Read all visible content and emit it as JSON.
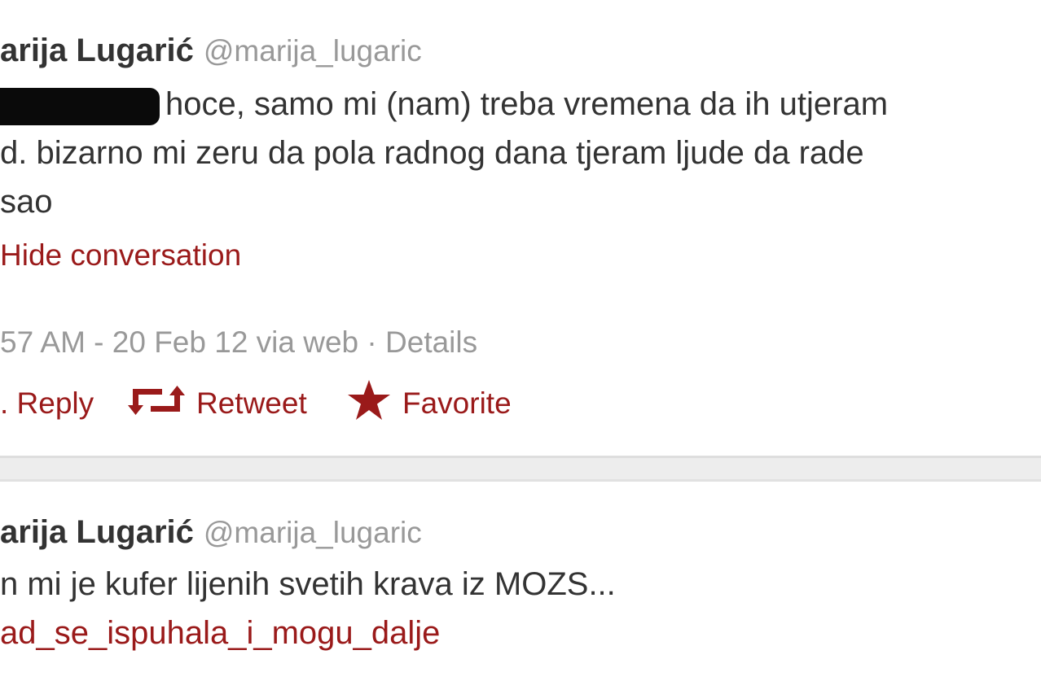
{
  "tweets": [
    {
      "fullname": "arija Lugarić",
      "username": "@marija_lugaric",
      "text_lines": [
        "hoce, samo mi (nam) treba vremena da ih utjeram",
        "d. bizarno mi zeru da pola radnog dana tjeram ljude da rade",
        "sao"
      ],
      "hide_conversation": "Hide conversation",
      "meta": "57 AM - 20 Feb 12 via web · Details",
      "actions": {
        "reply": ". Reply",
        "retweet": "Retweet",
        "favorite": "Favorite"
      }
    },
    {
      "fullname": "arija Lugarić",
      "username": "@marija_lugaric",
      "text_lines": [
        "n mi je kufer lijenih svetih krava iz MOZS..."
      ],
      "hashtag": "ad_se_ispuhala_i_mogu_dalje"
    }
  ],
  "colors": {
    "link": "#9a1a1a",
    "text": "#333333",
    "muted": "#999999",
    "separator": "#ededed"
  },
  "icons": {
    "retweet": "retweet-icon",
    "favorite": "star-icon"
  }
}
